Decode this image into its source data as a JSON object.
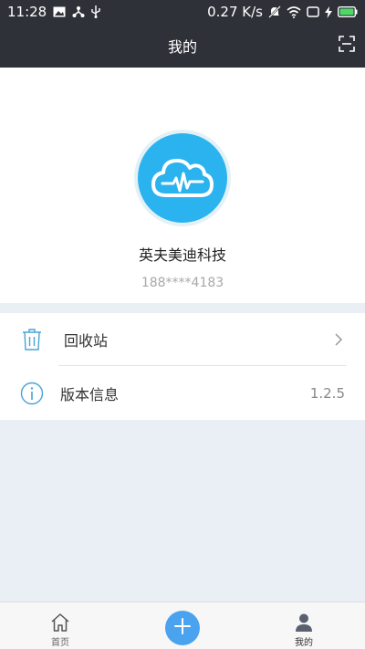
{
  "status_bar": {
    "time": "11:28",
    "network_speed": "0.27 K/s",
    "icons": [
      "image-icon",
      "usb-share-icon",
      "usb-icon",
      "mute-icon",
      "wifi-icon",
      "screen-icon",
      "charging-icon",
      "battery-icon"
    ],
    "battery_color": "#4cd964"
  },
  "header": {
    "title": "我的",
    "scan_icon": "scan-icon"
  },
  "profile": {
    "avatar_icon": "cloud-pulse-icon",
    "avatar_color": "#2ab3ee",
    "name": "英夫美迪科技",
    "phone": "188****4183"
  },
  "menu": {
    "items": [
      {
        "label": "回收站",
        "icon": "trash-icon",
        "trailing": "chevron-right-icon"
      },
      {
        "label": "版本信息",
        "icon": "info-icon",
        "value": "1.2.5"
      }
    ]
  },
  "bottom_nav": {
    "items": [
      {
        "label": "首页",
        "icon": "home-icon"
      },
      {
        "label": "",
        "icon": "plus-icon"
      },
      {
        "label": "我的",
        "icon": "user-icon",
        "active": true
      }
    ],
    "accent": "#4aa3ef"
  }
}
